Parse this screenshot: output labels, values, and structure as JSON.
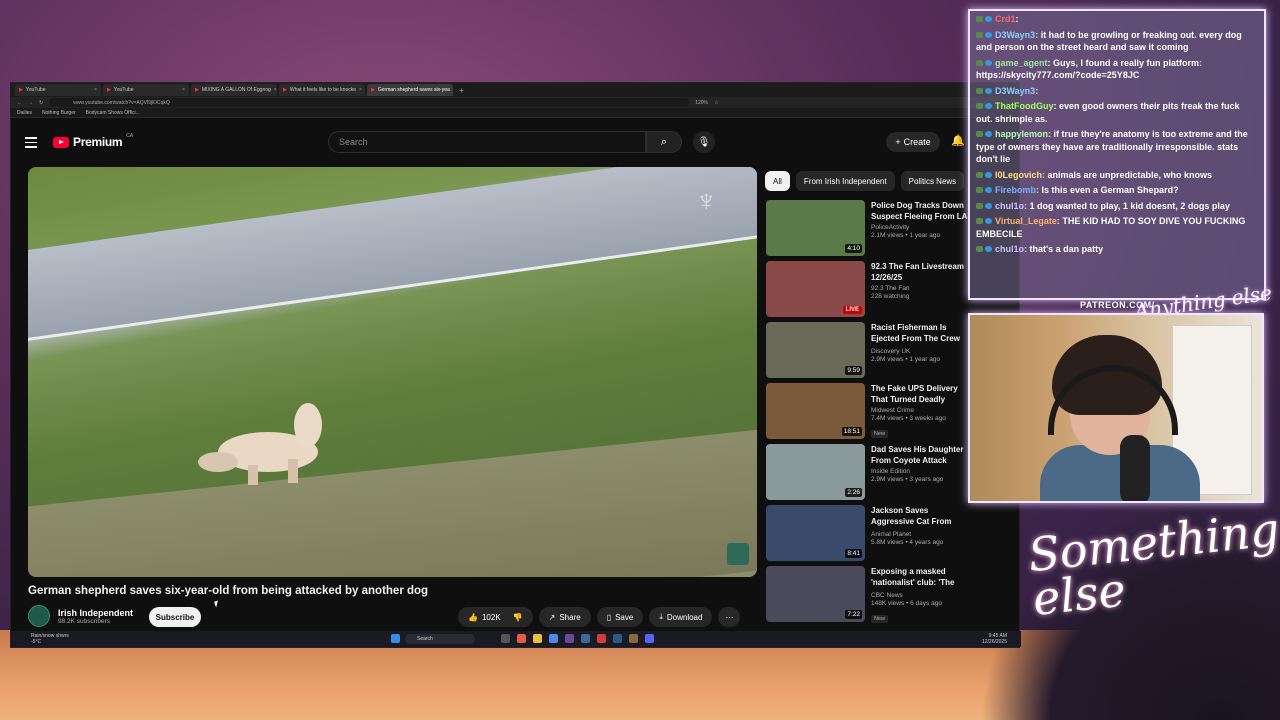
{
  "browser": {
    "tabs": [
      {
        "label": "YouTube",
        "active": false
      },
      {
        "label": "YouTube",
        "active": false
      },
      {
        "label": "MIXING A GALLON Of Eggnog",
        "active": false
      },
      {
        "label": "What it feels like to be knocke",
        "active": false
      },
      {
        "label": "German shepherd saves six-yea",
        "active": true
      }
    ],
    "url": "www.youtube.com/watch?v=AQVl9jlOCqkQ",
    "zoom": "120%",
    "bookmarks": [
      "Dailies",
      "Nothing Burger",
      "Bodycam Shows Offici..."
    ]
  },
  "youtube": {
    "logo_text": "Premium",
    "logo_region": "CA",
    "search_placeholder": "Search",
    "create_label": "Create",
    "video_title": "German shepherd saves six-year-old from being attacked by another dog",
    "channel_name": "Irish Independent",
    "channel_subs": "98.2K subscribers",
    "subscribe_label": "Subscribe",
    "like_count": "102K",
    "share_label": "Share",
    "save_label": "Save",
    "download_label": "Download",
    "chips": [
      "All",
      "From Irish Independent",
      "Politics News"
    ],
    "recommendations": [
      {
        "title": "Police Dog Tracks Down Suspect Fleeing From LA",
        "channel": "PoliceActivity",
        "meta": "2.1M views • 1 year ago",
        "duration": "4:10",
        "color": "#5a7a4a"
      },
      {
        "title": "92.3 The Fan Livestream 12/26/25",
        "channel": "92.3 The Fan",
        "meta": "228 watching",
        "duration": "LIVE",
        "color": "#8a4a4a"
      },
      {
        "title": "Racist Fisherman Is Ejected From The Crew By Captain",
        "channel": "Discovery UK",
        "meta": "2.9M views • 1 year ago",
        "duration": "9:59",
        "color": "#6a6a5a"
      },
      {
        "title": "The Fake UPS Delivery That Turned Deadly",
        "channel": "Midwest Crime",
        "meta": "7.4M views • 3 weeks ago",
        "duration": "18:51",
        "badge": "New",
        "color": "#7a5a3a"
      },
      {
        "title": "Dad Saves His Daughter From Coyote Attack",
        "channel": "Inside Edition",
        "meta": "2.9M views • 3 years ago",
        "duration": "2:26",
        "color": "#8a9a9a"
      },
      {
        "title": "Jackson Saves Aggressive Cat From Being \"Put Down\" | My C...",
        "channel": "Animal Planet",
        "meta": "5.8M views • 4 years ago",
        "duration": "8:41",
        "color": "#3a4a6a"
      },
      {
        "title": "Exposing a masked 'nationalist' club: 'The race war is here'",
        "channel": "CBC News",
        "meta": "148K views • 6 days ago",
        "duration": "7:22",
        "badge": "New",
        "color": "#4a4a5a"
      }
    ]
  },
  "taskbar": {
    "weather": "Rain/snow shwrs",
    "temp": "-5°C",
    "search": "Search",
    "time": "9:45 AM",
    "date": "12/26/2025"
  },
  "chat": {
    "messages": [
      {
        "user": "Crd1",
        "text": "",
        "color": "#ff6a6a"
      },
      {
        "user": "D3Wayn3",
        "text": "it had to be growling or freaking out. every dog and person on the street heard and saw it coming",
        "color": "#8ad0ff"
      },
      {
        "user": "game_agent",
        "text": "Guys, I found a really fun platform: https://skycity777.com/?code=25Y8JC",
        "color": "#9ae8a0"
      },
      {
        "user": "D3Wayn3",
        "text": "",
        "color": "#8ad0ff"
      },
      {
        "user": "ThatFoodGuy",
        "text": "even good owners their pits freak the fuck out. shrimple as.",
        "color": "#a0ff60"
      },
      {
        "user": "happylemon",
        "text": "if true they're anatomy is too extreme and the type of owners they have are traditionally irresponsible. stats don't lie",
        "color": "#b0ffb0"
      },
      {
        "user": "l0Legovich",
        "text": "animals are unpredictable, who knows",
        "color": "#ffe080"
      },
      {
        "user": "Firebomb",
        "text": "Is this even a German Shepard?",
        "color": "#7ab0ff"
      },
      {
        "user": "chul1o",
        "text": "1 dog wanted to play, 1 kid doesnt, 2 dogs play",
        "color": "#d0c0ff"
      },
      {
        "user": "Virtual_Legate",
        "text": "THE KID HAD TO SOY DIVE YOU FUCKING EMBECILE",
        "color": "#ffb070"
      },
      {
        "user": "chul1o",
        "text": "that's a dan patty",
        "color": "#d0c0ff"
      }
    ]
  },
  "overlay": {
    "patreon": "PATREON.COM/",
    "signature_small": "Anything else",
    "signature_large": "Something else"
  }
}
